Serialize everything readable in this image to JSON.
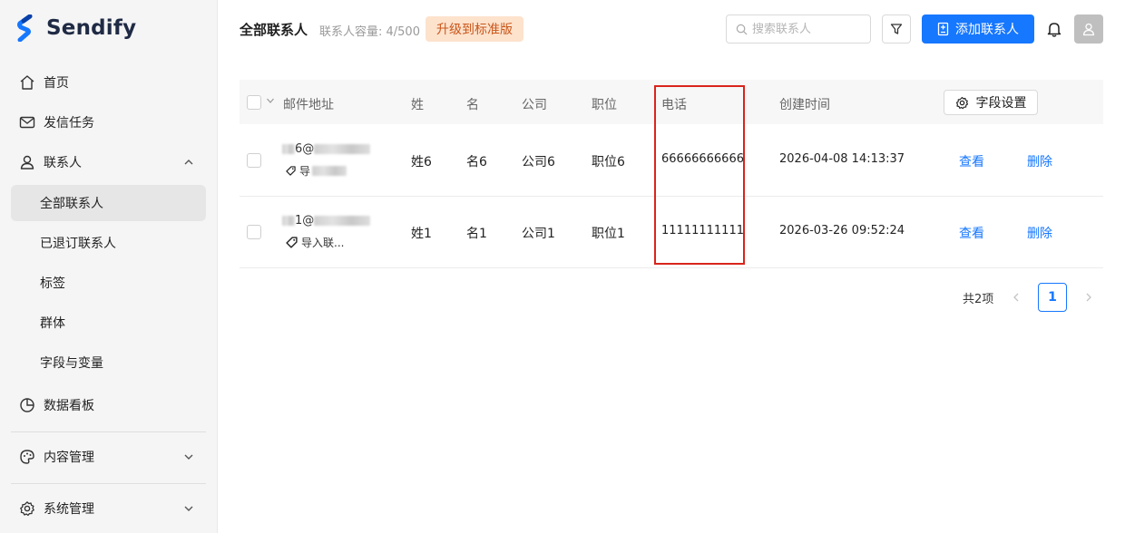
{
  "app": {
    "name": "Sendify"
  },
  "sidebar": {
    "home": "首页",
    "campaigns": "发信任务",
    "contacts": "联系人",
    "contacts_sub": [
      "全部联系人",
      "已退订联系人",
      "标签",
      "群体",
      "字段与变量"
    ],
    "dashboard": "数据看板",
    "content": "内容管理",
    "system": "系统管理"
  },
  "header": {
    "title": "全部联系人",
    "capacity": "联系人容量: 4/500",
    "upgrade": "升级到标准版",
    "search_placeholder": "搜索联系人",
    "add_button": "添加联系人"
  },
  "table": {
    "columns": {
      "email": "邮件地址",
      "last_name": "姓",
      "first_name": "名",
      "company": "公司",
      "title": "职位",
      "phone": "电话",
      "created": "创建时间"
    },
    "field_settings": "字段设置",
    "rows": [
      {
        "email_prefix": "6@",
        "tag": "导",
        "last_name": "姓6",
        "first_name": "名6",
        "company": "公司6",
        "title": "职位6",
        "phone": "66666666666",
        "created": "2026-04-08 14:13:37",
        "view": "查看",
        "delete": "删除"
      },
      {
        "email_prefix": "1@",
        "tag": "导入联...",
        "last_name": "姓1",
        "first_name": "名1",
        "company": "公司1",
        "title": "职位1",
        "phone": "11111111111",
        "created": "2026-03-26 09:52:24",
        "view": "查看",
        "delete": "删除"
      }
    ]
  },
  "pagination": {
    "total": "共2项",
    "current": "1"
  },
  "colors": {
    "primary": "#1677ff",
    "highlight": "#d9241c",
    "upgrade_bg": "#fde2cc",
    "upgrade_text": "#c9571b"
  }
}
